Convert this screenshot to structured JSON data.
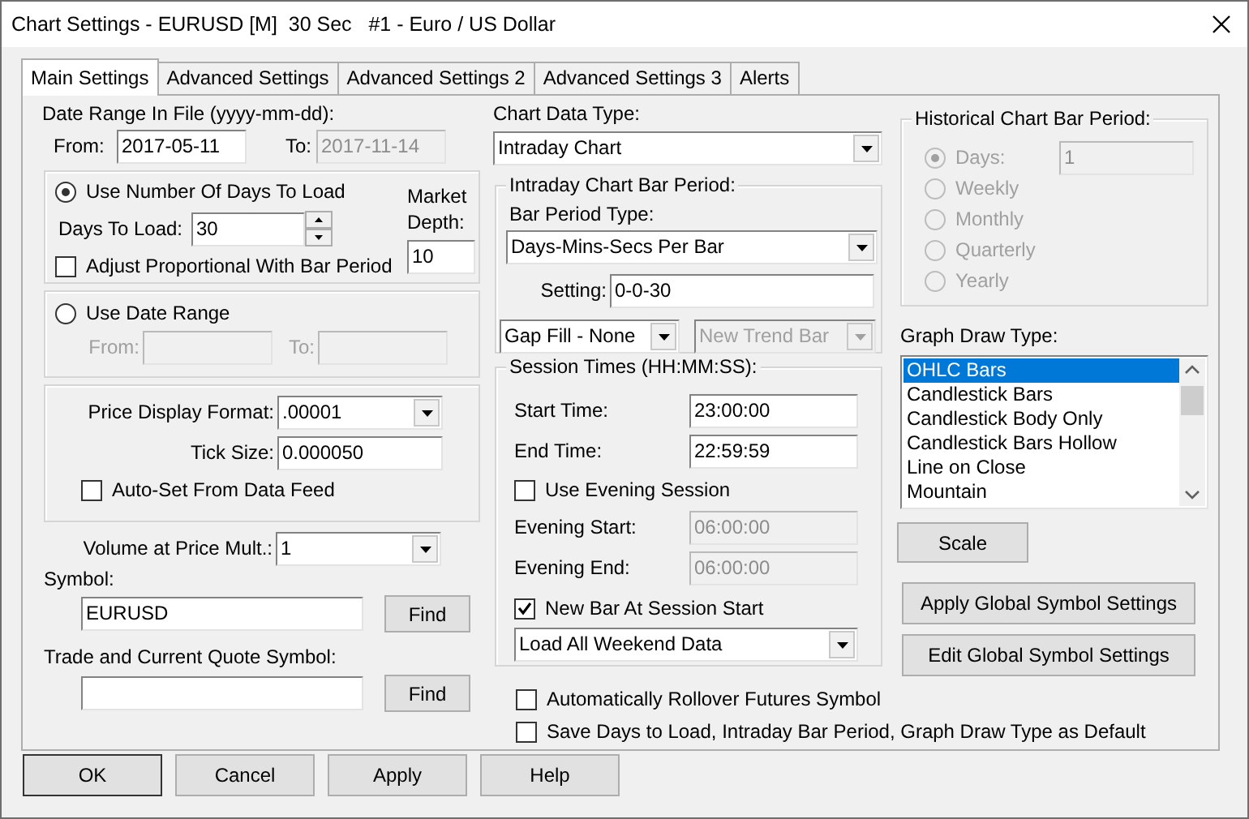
{
  "window": {
    "title": "Chart Settings - EURUSD [M]  30 Sec   #1 - Euro / US Dollar"
  },
  "tabs": [
    {
      "label": "Main Settings",
      "selected": true
    },
    {
      "label": "Advanced Settings",
      "selected": false
    },
    {
      "label": "Advanced Settings 2",
      "selected": false
    },
    {
      "label": "Advanced Settings 3",
      "selected": false
    },
    {
      "label": "Alerts",
      "selected": false
    }
  ],
  "date_range": {
    "label": "Date Range In File (yyyy-mm-dd):",
    "from_label": "From:",
    "from": "2017-05-11",
    "to_label": "To:",
    "to": "2017-11-14",
    "to_disabled": true
  },
  "days_group": {
    "radio_label": "Use Number Of Days To Load",
    "selected": true,
    "days_label": "Days To Load:",
    "days": "30",
    "adjust_label": "Adjust Proportional With Bar Period",
    "adjust_checked": false,
    "market_depth_label": "Market Depth:",
    "market_depth": "10"
  },
  "date_range_group": {
    "radio_label": "Use Date Range",
    "selected": false,
    "from_label": "From:",
    "to_label": "To:"
  },
  "price_group": {
    "format_label": "Price Display Format:",
    "format": ".00001",
    "tick_label": "Tick Size:",
    "tick": "0.000050",
    "auto_label": "Auto-Set From Data Feed",
    "auto_checked": false
  },
  "volume": {
    "label": "Volume at Price Mult.:",
    "value": "1"
  },
  "symbol": {
    "label": "Symbol:",
    "value": "EURUSD",
    "button": "Find"
  },
  "trade_symbol": {
    "label": "Trade and Current Quote Symbol:",
    "button": "Find"
  },
  "chart_data_type": {
    "label": "Chart Data Type:",
    "value": "Intraday Chart"
  },
  "intraday": {
    "title": "Intraday Chart Bar Period:",
    "type_label": "Bar Period Type:",
    "type": "Days-Mins-Secs Per Bar",
    "setting_label": "Setting:",
    "setting": "0-0-30",
    "gap_fill": "Gap Fill - None",
    "trend": "New Trend Bar",
    "trend_disabled": true
  },
  "session": {
    "title": "Session Times (HH:MM:SS):",
    "start_label": "Start Time:",
    "start": "23:00:00",
    "end_label": "End Time:",
    "end": "22:59:59",
    "evening_label": "Use Evening Session",
    "evening_checked": false,
    "evening_start_label": "Evening Start:",
    "evening_start": "06:00:00",
    "evening_end_label": "Evening End:",
    "evening_end": "06:00:00",
    "new_bar_label": "New Bar At Session Start",
    "new_bar_checked": true,
    "weekend": "Load All Weekend Data"
  },
  "options": [
    {
      "label": "Automatically Rollover Futures Symbol",
      "checked": false
    },
    {
      "label": "Save Days to Load, Intraday Bar Period, Graph Draw Type as Default",
      "checked": false
    }
  ],
  "historical": {
    "title": "Historical Chart Bar Period:",
    "disabled": true,
    "days": "1",
    "options": [
      {
        "label": "Days:",
        "selected": true
      },
      {
        "label": "Weekly",
        "selected": false
      },
      {
        "label": "Monthly",
        "selected": false
      },
      {
        "label": "Quarterly",
        "selected": false
      },
      {
        "label": "Yearly",
        "selected": false
      }
    ]
  },
  "graph_draw": {
    "label": "Graph Draw Type:",
    "items": [
      {
        "label": "OHLC Bars",
        "selected": true
      },
      {
        "label": "Candlestick Bars",
        "selected": false
      },
      {
        "label": "Candlestick Body Only",
        "selected": false
      },
      {
        "label": "Candlestick Bars Hollow",
        "selected": false
      },
      {
        "label": "Line on Close",
        "selected": false
      },
      {
        "label": "Mountain",
        "selected": false
      }
    ]
  },
  "side_buttons": [
    "Scale",
    "Apply Global Symbol Settings",
    "Edit Global Symbol Settings"
  ],
  "buttons": [
    "OK",
    "Cancel",
    "Apply",
    "Help"
  ]
}
